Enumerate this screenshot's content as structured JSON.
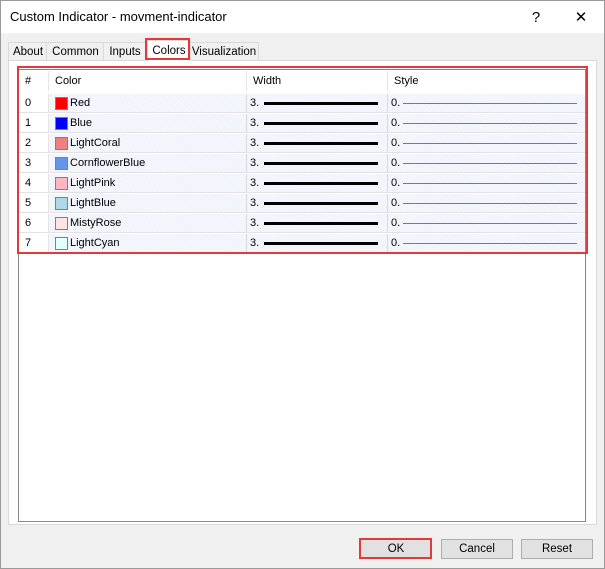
{
  "window": {
    "title": "Custom Indicator - movment-indicator",
    "help_label": "?",
    "close_label": "✕"
  },
  "tabs": [
    {
      "label": "About"
    },
    {
      "label": "Common"
    },
    {
      "label": "Inputs"
    },
    {
      "label": "Colors",
      "active": true
    },
    {
      "label": "Visualization"
    }
  ],
  "table": {
    "headers": {
      "index": "#",
      "color": "Color",
      "width": "Width",
      "style": "Style"
    },
    "rows": [
      {
        "index": "0",
        "color_name": "Red",
        "color_hex": "#ff0000",
        "width": "3.",
        "style": "0."
      },
      {
        "index": "1",
        "color_name": "Blue",
        "color_hex": "#0000ff",
        "width": "3.",
        "style": "0."
      },
      {
        "index": "2",
        "color_name": "LightCoral",
        "color_hex": "#f08080",
        "width": "3.",
        "style": "0."
      },
      {
        "index": "3",
        "color_name": "CornflowerBlue",
        "color_hex": "#6495ed",
        "width": "3.",
        "style": "0."
      },
      {
        "index": "4",
        "color_name": "LightPink",
        "color_hex": "#ffb6c1",
        "width": "3.",
        "style": "0."
      },
      {
        "index": "5",
        "color_name": "LightBlue",
        "color_hex": "#add8e6",
        "width": "3.",
        "style": "0."
      },
      {
        "index": "6",
        "color_name": "MistyRose",
        "color_hex": "#ffe4e1",
        "width": "3.",
        "style": "0."
      },
      {
        "index": "7",
        "color_name": "LightCyan",
        "color_hex": "#e0ffff",
        "width": "3.",
        "style": "0."
      }
    ]
  },
  "buttons": {
    "ok": "OK",
    "cancel": "Cancel",
    "reset": "Reset"
  },
  "accent": {
    "highlight": "#e03a3a",
    "focus": "#0078d7"
  }
}
